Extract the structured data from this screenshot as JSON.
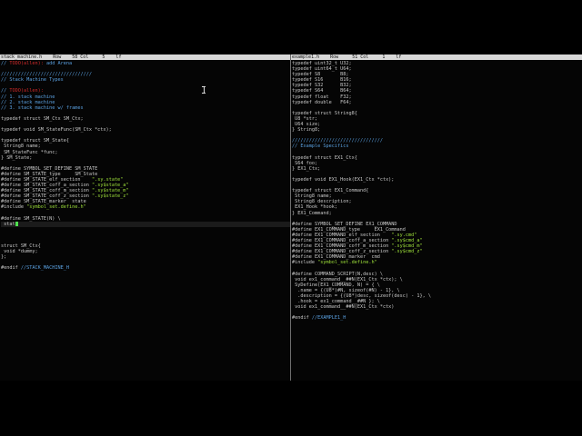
{
  "left": {
    "status": "stack_machine.h    Row    58 Col     5    lf",
    "lines": [
      {
        "t": "// ",
        "r": "TODO(allen):",
        "a": " add Arena",
        "c": "comment"
      },
      {
        "t": ""
      },
      {
        "t": "////////////////////////////////",
        "c": "comment"
      },
      {
        "t": "// Stack Machine Types",
        "c": "comment"
      },
      {
        "t": ""
      },
      {
        "t": "// ",
        "r": "TODO(allen):",
        "c": "comment"
      },
      {
        "t": "// 1. stack machine",
        "c": "comment"
      },
      {
        "t": "// 2. stack machine",
        "c": "comment"
      },
      {
        "t": "// 3. stack machine w/ frames",
        "c": "comment"
      },
      {
        "t": ""
      },
      {
        "t": "typedef struct SM_Ctx SM_Ctx;"
      },
      {
        "t": ""
      },
      {
        "t": "typedef void SM_StateFunc(SM_Ctx *ctx);"
      },
      {
        "t": ""
      },
      {
        "t": "typedef struct SM_State{"
      },
      {
        "t": " String8 name;"
      },
      {
        "t": " SM_StateFunc *func;"
      },
      {
        "t": "} SM_State;"
      },
      {
        "t": ""
      },
      {
        "t": "#define SYMBOL_SET_DEFINE SM_STATE"
      },
      {
        "t": "#define SM_STATE_type     SM_State"
      },
      {
        "t": "#define SM_STATE_elf_section    ",
        "s": "\".sy.state\""
      },
      {
        "t": "#define SM_STATE_coff_a_section ",
        "s": "\".sy$state_a\""
      },
      {
        "t": "#define SM_STATE_coff_m_section ",
        "s": "\".sy$state_m\""
      },
      {
        "t": "#define SM_STATE_coff_z_section ",
        "s": "\".sy$state_z\""
      },
      {
        "t": "#define SM_STATE_marker  state"
      },
      {
        "t": "#include ",
        "s": "\"symbol_set.define.h\""
      },
      {
        "t": ""
      },
      {
        "t": "#define SM_STATE(N) \\"
      },
      {
        "t": " stat",
        "cur": true
      },
      {
        "t": ""
      },
      {
        "t": ""
      },
      {
        "t": ""
      },
      {
        "t": "struct SM_Ctx{"
      },
      {
        "t": " void *dummy;"
      },
      {
        "t": "};"
      },
      {
        "t": ""
      },
      {
        "t": "#endif ",
        "k": "//STACK_MACHINE_H"
      }
    ]
  },
  "right": {
    "status": "example1.h    Row     51 Col     1    lf",
    "lines": [
      {
        "t": "typedef uint32_t U32;"
      },
      {
        "t": "typedef uint64_t U64;"
      },
      {
        "t": "typedef S8       B8;"
      },
      {
        "t": "typedef S16      B16;"
      },
      {
        "t": "typedef S32      B32;"
      },
      {
        "t": "typedef S64      B64;"
      },
      {
        "t": "typedef float    F32;"
      },
      {
        "t": "typedef double   F64;"
      },
      {
        "t": ""
      },
      {
        "t": "typedef struct String8{"
      },
      {
        "t": " U8 *str;"
      },
      {
        "t": " U64 size;"
      },
      {
        "t": "} String8;"
      },
      {
        "t": ""
      },
      {
        "t": "////////////////////////////////",
        "c": "comment"
      },
      {
        "t": "// Example Specifics",
        "c": "comment"
      },
      {
        "t": ""
      },
      {
        "t": "typedef struct EX1_Ctx{"
      },
      {
        "t": " S64 foo;"
      },
      {
        "t": "} EX1_Ctx;"
      },
      {
        "t": ""
      },
      {
        "t": "typedef void EX1_Hook(EX1_Ctx *ctx);"
      },
      {
        "t": ""
      },
      {
        "t": "typedef struct EX1_Command{"
      },
      {
        "t": " String8 name;"
      },
      {
        "t": " String8 description;"
      },
      {
        "t": " EX1_Hook *hook;"
      },
      {
        "t": "} EX1_Command;"
      },
      {
        "t": ""
      },
      {
        "t": "#define SYMBOL_SET_DEFINE EX1_COMMAND"
      },
      {
        "t": "#define EX1_COMMAND_type     EX1_Command"
      },
      {
        "t": "#define EX1_COMMAND_elf_section    ",
        "s": "\".sy.cmd\""
      },
      {
        "t": "#define EX1_COMMAND_coff_a_section ",
        "s": "\".sy$cmd_a\""
      },
      {
        "t": "#define EX1_COMMAND_coff_m_section ",
        "s": "\".sy$cmd_m\""
      },
      {
        "t": "#define EX1_COMMAND_coff_z_section ",
        "s": "\".sy$cmd_z\""
      },
      {
        "t": "#define EX1_COMMAND_marker  cmd"
      },
      {
        "t": "#include ",
        "s": "\"symbol_set.define.h\""
      },
      {
        "t": ""
      },
      {
        "t": "#define COMMAND_SCRIPT(N,desc) \\"
      },
      {
        "t": " void ex1_command__##N(EX1_Ctx *ctx); \\"
      },
      {
        "t": " SyDefine(EX1_COMMAND, N) = { \\"
      },
      {
        "t": "  .name = {(U8*)#N, sizeof(#N) - 1}, \\"
      },
      {
        "t": "  .description = {(U8*)desc, sizeof(desc) - 1}, \\"
      },
      {
        "t": "  .hook = ex1_command__##N }; \\"
      },
      {
        "t": " void ex1_command__##N(EX1_Ctx *ctx)"
      },
      {
        "t": ""
      },
      {
        "t": "#endif ",
        "k": "//EXAMPLE1_H"
      }
    ]
  }
}
